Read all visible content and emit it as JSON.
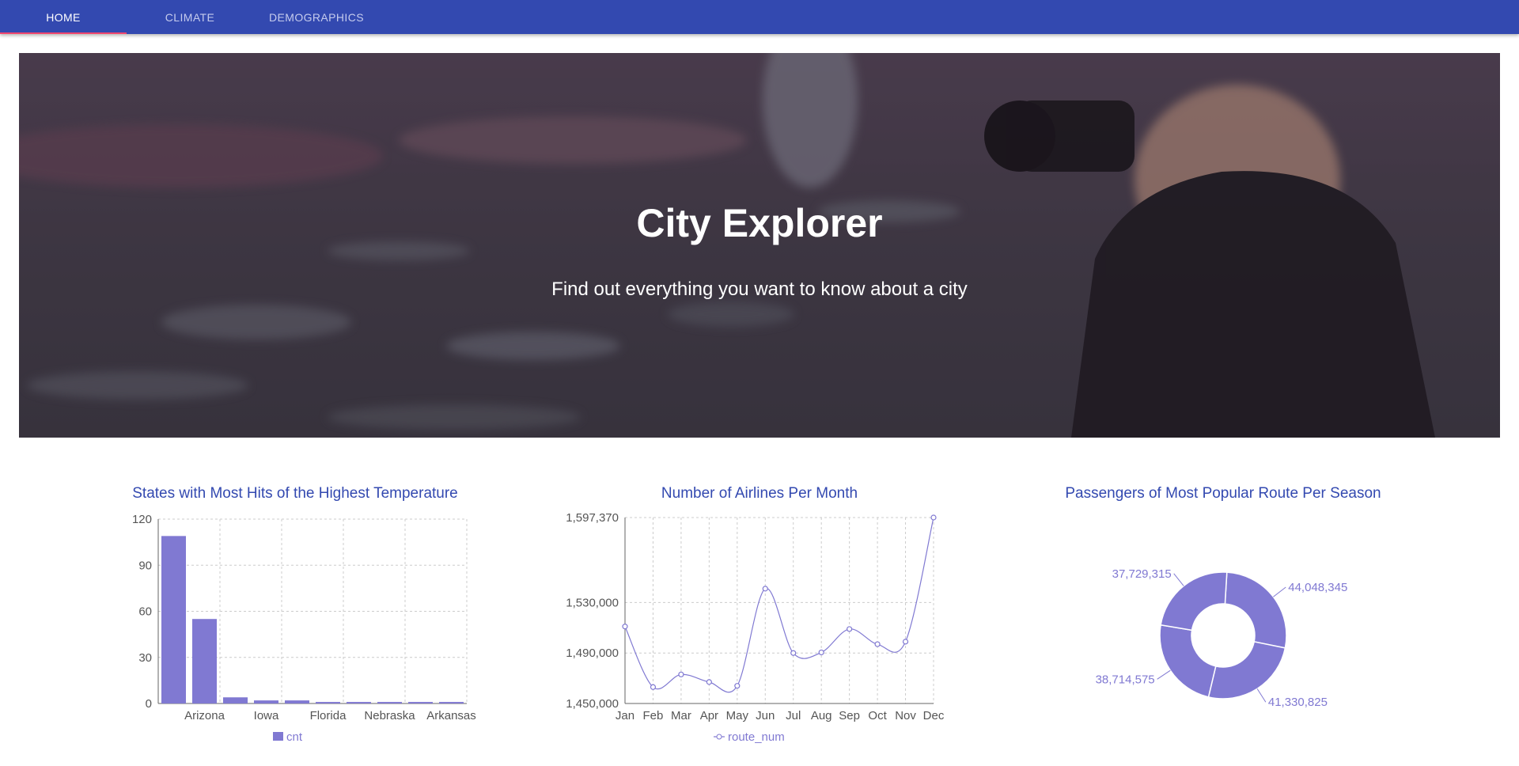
{
  "nav": {
    "tabs": [
      {
        "label": "HOME",
        "active": true
      },
      {
        "label": "CLIMATE",
        "active": false
      },
      {
        "label": "DEMOGRAPHICS",
        "active": false
      }
    ]
  },
  "hero": {
    "title": "City Explorer",
    "subtitle": "Find out everything you want to know about a city"
  },
  "colors": {
    "nav_bg": "#3349b0",
    "accent": "#f0466f",
    "series": "#8079d2",
    "title": "#3349b0"
  },
  "chart_data": [
    {
      "type": "bar",
      "title": "States with Most Hits of the Highest Temperature",
      "categories": [
        "",
        "Arizona",
        "",
        "Iowa",
        "",
        "Florida",
        "",
        "Nebraska",
        "",
        "Arkansas"
      ],
      "series": [
        {
          "name": "cnt",
          "values": [
            109,
            55,
            4,
            2,
            2,
            1,
            1,
            1,
            1,
            1
          ]
        }
      ],
      "yticks": [
        "0",
        "30",
        "60",
        "90",
        "120"
      ],
      "ylim": [
        0,
        120
      ],
      "grid": true,
      "legend": "bottom"
    },
    {
      "type": "line",
      "title": "Number of Airlines Per Month",
      "categories": [
        "Jan",
        "Feb",
        "Mar",
        "Apr",
        "May",
        "Jun",
        "Jul",
        "Aug",
        "Sep",
        "Oct",
        "Nov",
        "Dec"
      ],
      "series": [
        {
          "name": "route_num",
          "values": [
            1511000,
            1463000,
            1473000,
            1467000,
            1464000,
            1541000,
            1490000,
            1490500,
            1509000,
            1497000,
            1499000,
            1597370
          ]
        }
      ],
      "yticks": [
        "1,450,000",
        "1,490,000",
        "1,530,000",
        "1,597,370"
      ],
      "ylim": [
        1450000,
        1597370
      ],
      "grid": true,
      "legend": "bottom"
    },
    {
      "type": "pie",
      "title": "Passengers of Most Popular Route Per Season",
      "values": [
        44048345,
        41330825,
        38714575,
        37729315
      ],
      "labels": [
        "44,048,345",
        "41,330,825",
        "38,714,575",
        "37,729,315"
      ]
    }
  ]
}
